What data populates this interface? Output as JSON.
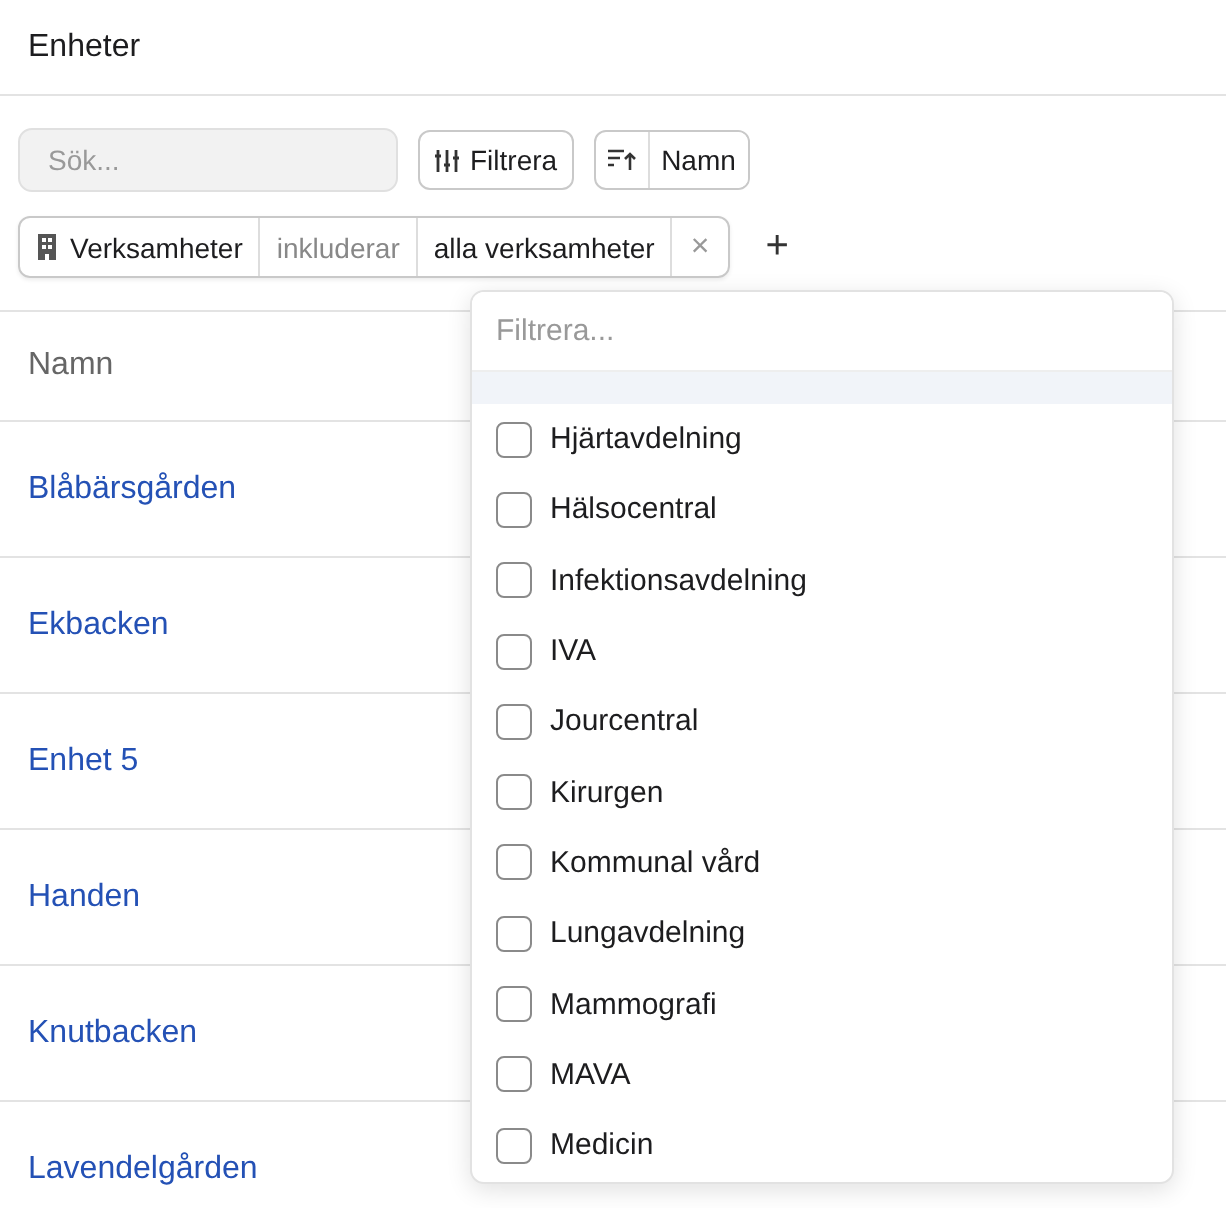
{
  "header": {
    "title": "Enheter"
  },
  "toolbar": {
    "search": {
      "placeholder": "Sök..."
    },
    "filter_button": "Filtrera",
    "sort_button": "Namn"
  },
  "active_filter": {
    "field": "Verksamheter",
    "operator": "inkluderar",
    "value": "alla verksamheter",
    "remove": "×"
  },
  "add_filter": "+",
  "table": {
    "column": "Namn",
    "rows": [
      "Blåbärsgården",
      "Ekbacken",
      "Enhet 5",
      "Handen",
      "Knutbacken",
      "Lavendelgården"
    ]
  },
  "dropdown": {
    "placeholder": "Filtrera...",
    "options": [
      {
        "label": "Hjärtavdelning",
        "checked": false
      },
      {
        "label": "Hälsocentral",
        "checked": false
      },
      {
        "label": "Infektionsavdelning",
        "checked": false
      },
      {
        "label": "IVA",
        "checked": false
      },
      {
        "label": "Jourcentral",
        "checked": false
      },
      {
        "label": "Kirurgen",
        "checked": false
      },
      {
        "label": "Kommunal vård",
        "checked": false
      },
      {
        "label": "Lungavdelning",
        "checked": false
      },
      {
        "label": "Mammografi",
        "checked": false
      },
      {
        "label": "MAVA",
        "checked": false
      },
      {
        "label": "Medicin",
        "checked": false
      }
    ]
  }
}
